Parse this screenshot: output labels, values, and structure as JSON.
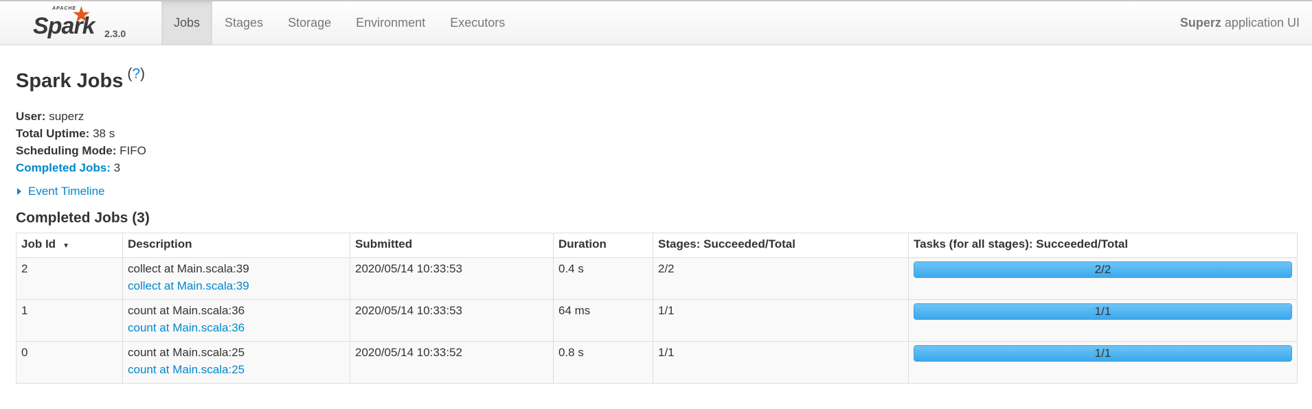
{
  "brand": {
    "apache": "APACHE",
    "name": "Spark",
    "version": "2.3.0"
  },
  "nav": {
    "tabs": [
      {
        "label": "Jobs",
        "active": true
      },
      {
        "label": "Stages"
      },
      {
        "label": "Storage"
      },
      {
        "label": "Environment"
      },
      {
        "label": "Executors"
      }
    ],
    "app_name": "Superz",
    "app_suffix": " application UI"
  },
  "page": {
    "title": "Spark Jobs",
    "help_open": "(",
    "help_link": "?",
    "help_close": ")"
  },
  "summary": {
    "user_label": "User:",
    "user_value": "superz",
    "uptime_label": "Total Uptime:",
    "uptime_value": "38 s",
    "mode_label": "Scheduling Mode:",
    "mode_value": "FIFO",
    "completed_label": "Completed Jobs:",
    "completed_value": "3"
  },
  "timeline": {
    "label": "Event Timeline"
  },
  "completed_section": {
    "title": "Completed Jobs (3)"
  },
  "table": {
    "headers": {
      "job_id": "Job Id",
      "description": "Description",
      "submitted": "Submitted",
      "duration": "Duration",
      "stages": "Stages: Succeeded/Total",
      "tasks": "Tasks (for all stages): Succeeded/Total"
    },
    "rows": [
      {
        "job_id": "2",
        "desc": "collect at Main.scala:39",
        "desc_link": "collect at Main.scala:39",
        "submitted": "2020/05/14 10:33:53",
        "duration": "0.4 s",
        "stages": "2/2",
        "tasks": "2/2",
        "progress": 1.0
      },
      {
        "job_id": "1",
        "desc": "count at Main.scala:36",
        "desc_link": "count at Main.scala:36",
        "submitted": "2020/05/14 10:33:53",
        "duration": "64 ms",
        "stages": "1/1",
        "tasks": "1/1",
        "progress": 1.0
      },
      {
        "job_id": "0",
        "desc": "count at Main.scala:25",
        "desc_link": "count at Main.scala:25",
        "submitted": "2020/05/14 10:33:52",
        "duration": "0.8 s",
        "stages": "1/1",
        "tasks": "1/1",
        "progress": 1.0
      }
    ]
  },
  "colors": {
    "link": "#0088cc",
    "progress": "#3aa9ec",
    "spark_star": "#e25a1c"
  },
  "icons": {
    "sort": "sort-desc-icon",
    "expand": "triangle-right-icon",
    "logo_star": "star-icon"
  }
}
